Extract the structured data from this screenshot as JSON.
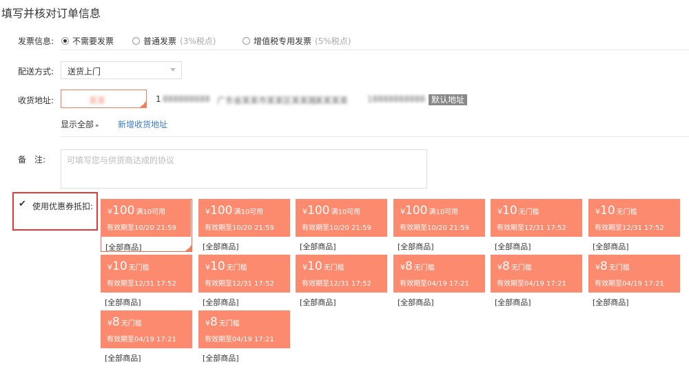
{
  "title": "填写并核对订单信息",
  "invoice": {
    "label": "发票信息:",
    "options": [
      {
        "label": "不需要发票",
        "hint": "",
        "selected": true
      },
      {
        "label": "普通发票",
        "hint": "(3%税点)",
        "selected": false
      },
      {
        "label": "增值税专用发票",
        "hint": "(5%税点)",
        "selected": false
      }
    ]
  },
  "delivery": {
    "label": "配送方式:",
    "value": "送货上门"
  },
  "address": {
    "label": "收货地址:",
    "name": "某某",
    "blurred": [
      "1",
      "888888888",
      "广东省某某市某某区某某路",
      "某某某某",
      "18888888888"
    ],
    "default_tag": "默认地址",
    "show_all": "显示全部",
    "show_all_icon": "double-chevron-down-icon",
    "add_new": "新增收货地址"
  },
  "remark": {
    "label": "备　注:",
    "placeholder": "可填写您与供货商达成的协议"
  },
  "coupon_toggle": {
    "label": "使用优惠券抵扣:",
    "checked": true
  },
  "coupons": [
    {
      "amount": "100",
      "cond": "满10可用",
      "expiry": "有效期至10/20 21:59",
      "scope": "[全部商品]",
      "selected": true
    },
    {
      "amount": "100",
      "cond": "满10可用",
      "expiry": "有效期至10/20 21:59",
      "scope": "[全部商品]",
      "selected": false
    },
    {
      "amount": "100",
      "cond": "满10可用",
      "expiry": "有效期至10/20 21:59",
      "scope": "[全部商品]",
      "selected": false
    },
    {
      "amount": "100",
      "cond": "满10可用",
      "expiry": "有效期至10/20 21:59",
      "scope": "[全部商品]",
      "selected": false
    },
    {
      "amount": "10",
      "cond": "无门槛",
      "expiry": "有效期至12/31 17:52",
      "scope": "[全部商品]",
      "selected": false
    },
    {
      "amount": "10",
      "cond": "无门槛",
      "expiry": "有效期至12/31 17:52",
      "scope": "[全部商品]",
      "selected": false
    },
    {
      "amount": "10",
      "cond": "无门槛",
      "expiry": "有效期至12/31 17:52",
      "scope": "[全部商品]",
      "selected": false
    },
    {
      "amount": "10",
      "cond": "无门槛",
      "expiry": "有效期至12/31 17:52",
      "scope": "[全部商品]",
      "selected": false
    },
    {
      "amount": "10",
      "cond": "无门槛",
      "expiry": "有效期至12/31 17:52",
      "scope": "[全部商品]",
      "selected": false
    },
    {
      "amount": "8",
      "cond": "无门槛",
      "expiry": "有效期至04/19 17:21",
      "scope": "[全部商品]",
      "selected": false
    },
    {
      "amount": "8",
      "cond": "无门槛",
      "expiry": "有效期至04/19 17:21",
      "scope": "[全部商品]",
      "selected": false
    },
    {
      "amount": "8",
      "cond": "无门槛",
      "expiry": "有效期至04/19 17:21",
      "scope": "[全部商品]",
      "selected": false
    },
    {
      "amount": "8",
      "cond": "无门槛",
      "expiry": "有效期至04/19 17:21",
      "scope": "[全部商品]",
      "selected": false
    },
    {
      "amount": "8",
      "cond": "无门槛",
      "expiry": "有效期至04/19 17:21",
      "scope": "[全部商品]",
      "selected": false
    }
  ],
  "currency_symbol": "¥",
  "colors": {
    "coupon": "#fb8a6e",
    "highlight": "#e53935",
    "link": "#3a7bd5"
  }
}
